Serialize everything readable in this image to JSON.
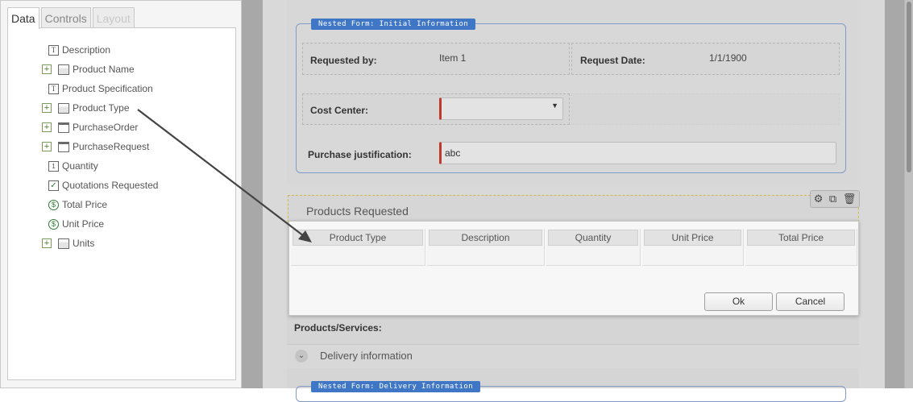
{
  "left_panel": {
    "tabs": [
      {
        "label": "Data",
        "state": "active"
      },
      {
        "label": "Controls",
        "state": "inactive"
      },
      {
        "label": "Layout",
        "state": "disabled"
      }
    ],
    "tree": [
      {
        "label": "Description",
        "icon": "text-field-icon",
        "expandable": false
      },
      {
        "label": "Product Name",
        "icon": "lookup-icon",
        "expandable": true
      },
      {
        "label": "Product Specification",
        "icon": "text-field-icon",
        "expandable": false
      },
      {
        "label": "Product Type",
        "icon": "lookup-icon",
        "expandable": true
      },
      {
        "label": "PurchaseOrder",
        "icon": "list-icon",
        "expandable": true
      },
      {
        "label": "PurchaseRequest",
        "icon": "list-icon",
        "expandable": true
      },
      {
        "label": "Quantity",
        "icon": "number-icon",
        "expandable": false
      },
      {
        "label": "Quotations Requested",
        "icon": "checkbox-icon",
        "expandable": false
      },
      {
        "label": "Total Price",
        "icon": "currency-icon",
        "expandable": false
      },
      {
        "label": "Unit Price",
        "icon": "currency-icon",
        "expandable": false
      },
      {
        "label": "Units",
        "icon": "lookup-icon",
        "expandable": true
      }
    ]
  },
  "form": {
    "nested_form_1_title": "Nested Form: Initial Information",
    "requested_by_label": "Requested by:",
    "requested_by_value": "Item 1",
    "request_date_label": "Request Date:",
    "request_date_value": "1/1/1900",
    "cost_center_label": "Cost Center:",
    "cost_center_value": "",
    "justification_label": "Purchase justification:",
    "justification_value": "abc",
    "products_section_title": "Products Requested",
    "products_services_label": "Products/Services:",
    "delivery_label": "Delivery information",
    "nested_form_2_title": "Nested Form: Delivery Information",
    "required_marker_color": "#c0392b",
    "nested_title_color": "#3f76c5"
  },
  "dialog": {
    "columns": [
      "Product Type",
      "Description",
      "Quantity",
      "Unit Price",
      "Total Price"
    ],
    "ok_label": "Ok",
    "cancel_label": "Cancel"
  }
}
